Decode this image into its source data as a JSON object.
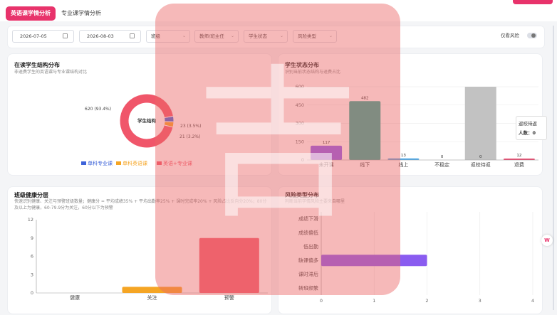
{
  "tabs": {
    "active": "英语课学情分析",
    "other": "专业课学情分析"
  },
  "filters": {
    "start_date": "2026-07-05",
    "end_date": "2026-08-03",
    "class": "班级",
    "teacher": "教师/班主任",
    "student_status": "学生状态",
    "risk_type": "风险类型",
    "risk_only": "仅看风险"
  },
  "cards": {
    "structure": {
      "title": "在读学生结构分布",
      "subtitle": "非退费学生的英语课与专业课结构对比",
      "center": "学生结构"
    },
    "status": {
      "title": "学生状态分布",
      "subtitle": "识别当前状态结构与退费占比"
    },
    "health": {
      "title": "班级健康分层",
      "subtitle": "快速识别健康、关注与预警班级数量；健康分 = 平均成绩35% + 平均出勤率25% + 课时完成率20% + 风险占比反向分20%；80分及以上为健康，60-79.9分为关注，60分以下为预警"
    },
    "risk": {
      "title": "风险类型分布",
      "subtitle": "判断当前学情风险主要来自哪里"
    }
  },
  "tooltip": {
    "title": "返校待返",
    "label": "人数：0"
  },
  "chart_data": [
    {
      "type": "pie",
      "title": "学生结构",
      "categories": [
        "单科专业课",
        "单科英语课",
        "英语+专业课"
      ],
      "values": [
        23,
        21,
        620
      ],
      "labels": [
        "23 (3.5%)",
        "21 (3.2%)",
        "620 (93.4%)"
      ],
      "colors": [
        "#3d63d9",
        "#f5a524",
        "#f0566a"
      ],
      "legend": "bottom"
    },
    {
      "type": "bar",
      "categories": [
        "未开课",
        "线下",
        "线上",
        "不稳定",
        "返校待返",
        "退费"
      ],
      "values": [
        117,
        482,
        13,
        0,
        0,
        12
      ],
      "colors": [
        "#8a5cf0",
        "#27ad98",
        "#4fa8e6",
        "#27ad98",
        "#c2c2c2",
        "#e8466c"
      ],
      "yticks": [
        0,
        150,
        300,
        450,
        600
      ],
      "ylim": [
        0,
        600
      ],
      "background_bars": [
        "返校待返"
      ]
    },
    {
      "type": "bar",
      "categories": [
        "健康",
        "关注",
        "预警"
      ],
      "values": [
        0,
        1,
        9
      ],
      "colors": [
        "#7ac27a",
        "#f5a524",
        "#f05e72"
      ],
      "yticks": [
        0,
        3,
        6,
        9,
        12
      ],
      "ylim": [
        0,
        12
      ]
    },
    {
      "type": "bar",
      "orientation": "horizontal",
      "categories": [
        "成绩下滑",
        "成绩偏低",
        "低出勤",
        "缺课偏多",
        "课时滞后",
        "转班频繁"
      ],
      "values": [
        0,
        0,
        0,
        2,
        0,
        0
      ],
      "colors": [
        "#8a5cf0"
      ],
      "xticks": [
        0,
        1,
        2,
        3,
        4
      ],
      "xlim": [
        0,
        4
      ]
    }
  ]
}
